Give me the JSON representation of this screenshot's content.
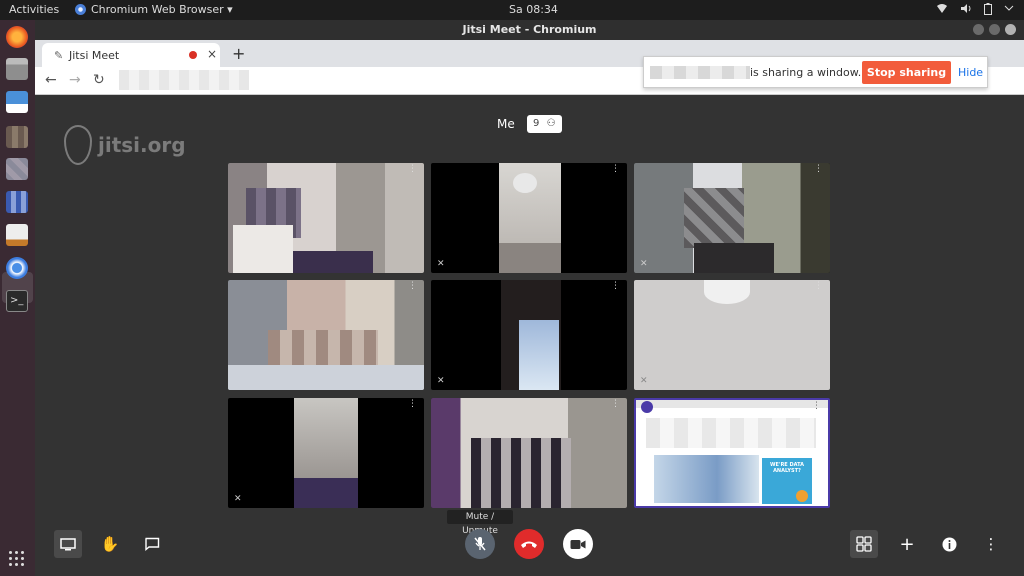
{
  "topbar": {
    "activities": "Activities",
    "app_name": "Chromium Web Browser ▾",
    "clock": "Sa 08:34",
    "tray_icons": [
      "wifi-icon",
      "volume-icon",
      "battery-icon",
      "power-menu-icon"
    ]
  },
  "window": {
    "title": "Jitsi Meet - Chromium"
  },
  "tab": {
    "label": "Jitsi Meet",
    "close": "×",
    "new_tab": "+"
  },
  "share_bar": {
    "message": "is sharing a window.",
    "stop_label": "Stop sharing",
    "hide_label": "Hide"
  },
  "jitsi": {
    "logo_text": "jitsi.org",
    "me_label": "Me",
    "participant_count": "9",
    "tooltip": "Mute / Unmute",
    "tiles": [
      {
        "id": "p1",
        "muted": false
      },
      {
        "id": "p2",
        "muted": true
      },
      {
        "id": "p3",
        "muted": true
      },
      {
        "id": "p4",
        "muted": false
      },
      {
        "id": "p5",
        "muted": true
      },
      {
        "id": "p6",
        "muted": true
      },
      {
        "id": "p7",
        "muted": true
      },
      {
        "id": "p8",
        "muted": false
      },
      {
        "id": "p9",
        "muted": false,
        "screen_share": true
      }
    ],
    "colors": {
      "hangup": "#e02b2b",
      "stop_sharing": "#f25c3b",
      "active_border": "#4a3aa8"
    }
  },
  "shared_slide": {
    "heading": "WE'RE DATA ANALYST?"
  }
}
